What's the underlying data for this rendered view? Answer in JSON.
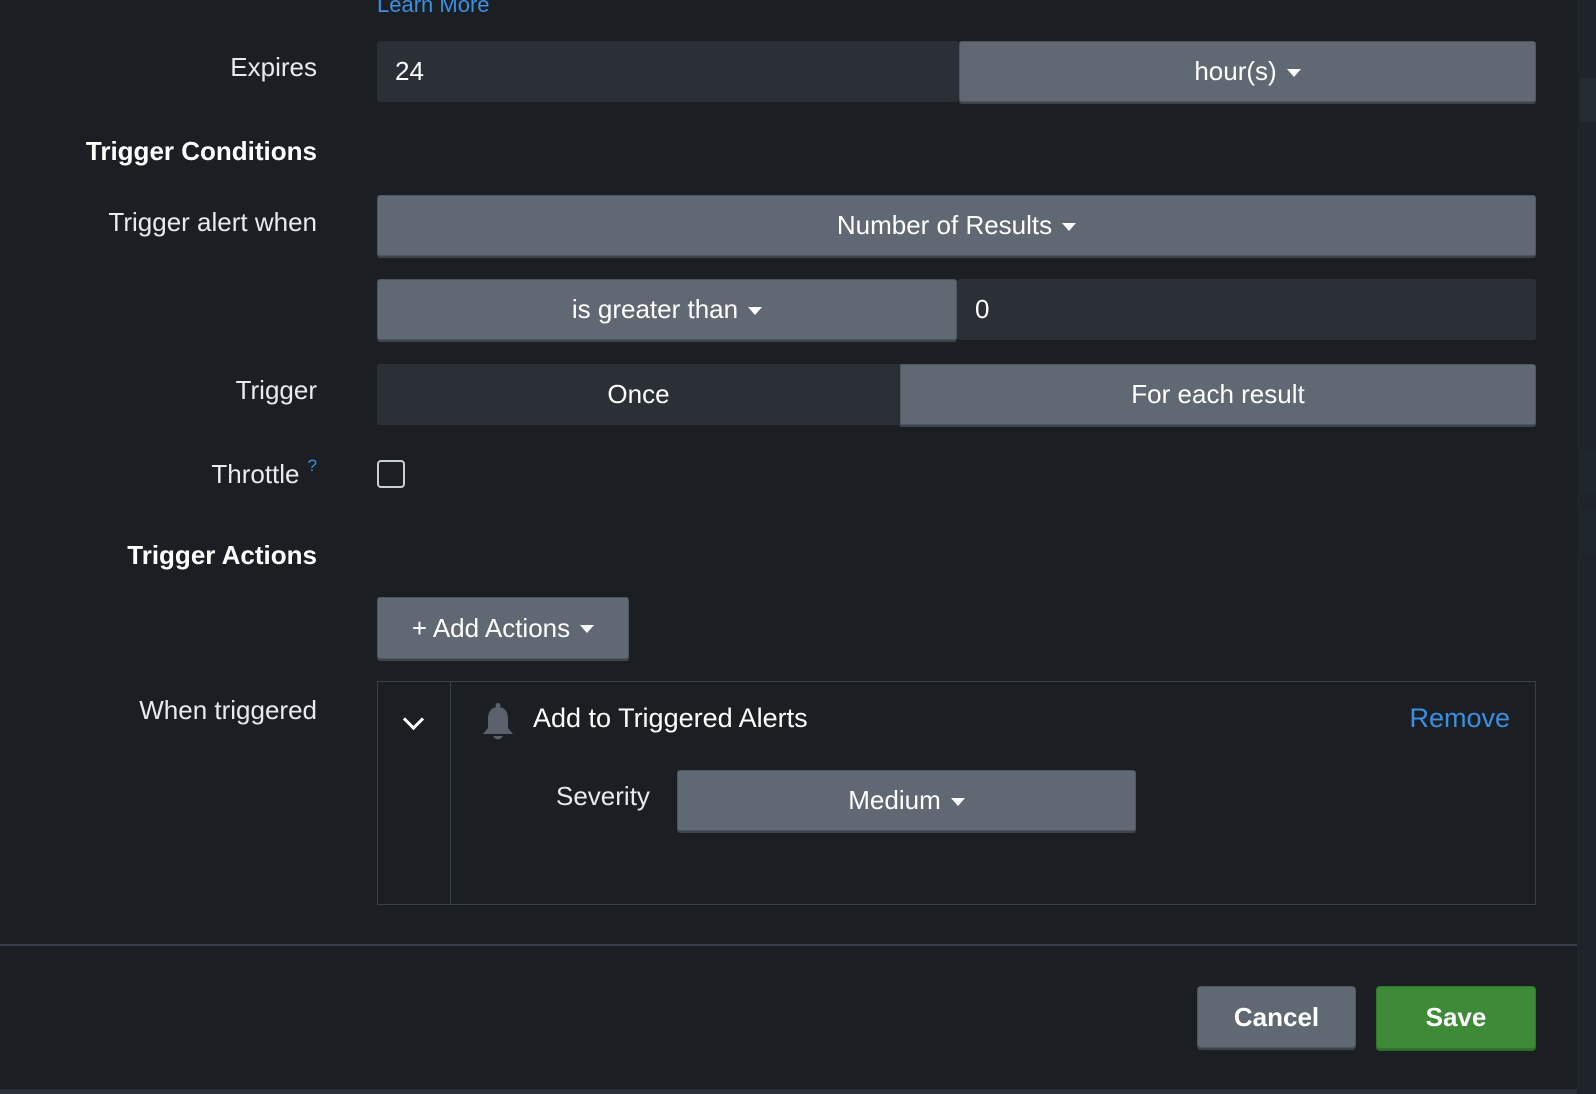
{
  "top": {
    "learn_more": "Learn More"
  },
  "expires": {
    "label": "Expires",
    "value": "24",
    "unit": "hour(s)"
  },
  "trigger_conditions": {
    "heading": "Trigger Conditions"
  },
  "trigger_alert_when": {
    "label": "Trigger alert when",
    "condition": "Number of Results",
    "comparator": "is greater than",
    "threshold": "0"
  },
  "trigger": {
    "label": "Trigger",
    "options": [
      "Once",
      "For each result"
    ],
    "selected": "For each result"
  },
  "throttle": {
    "label": "Throttle",
    "help": "?",
    "checked": false
  },
  "trigger_actions": {
    "heading": "Trigger Actions",
    "add_button": "+ Add Actions"
  },
  "when_triggered": {
    "label": "When triggered",
    "action": {
      "icon": "bell-icon",
      "title": "Add to Triggered Alerts",
      "remove": "Remove",
      "severity_label": "Severity",
      "severity_value": "Medium"
    }
  },
  "footer": {
    "cancel": "Cancel",
    "save": "Save"
  },
  "colors": {
    "background": "#1b1f24",
    "dropdown": "#606874",
    "input": "#2b3036",
    "link": "#3a8fe0",
    "save": "#3d8b37"
  }
}
